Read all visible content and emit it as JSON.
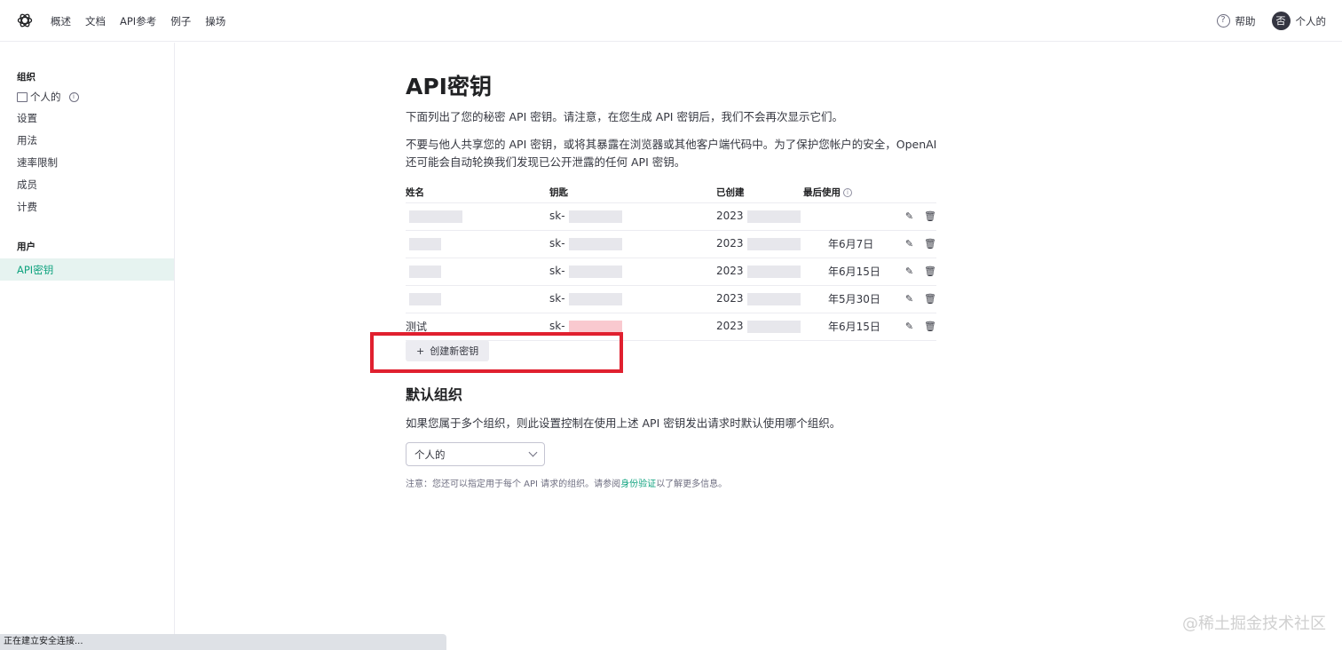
{
  "nav": {
    "links": [
      "概述",
      "文档",
      "API参考",
      "例子",
      "操场"
    ],
    "help": "帮助",
    "avatar_letter": "否",
    "account": "个人的"
  },
  "sidebar": {
    "org_heading": "组织",
    "org_name": "个人的",
    "items": [
      "设置",
      "用法",
      "速率限制",
      "成员",
      "计费"
    ],
    "user_heading": "用户",
    "active_item": "API密钥"
  },
  "main": {
    "title": "API密钥",
    "desc1": "下面列出了您的秘密 API 密钥。请注意，在您生成 API 密钥后，我们不会再次显示它们。",
    "desc2": "不要与他人共享您的 API 密钥，或将其暴露在浏览器或其他客户端代码中。为了保护您帐户的安全，OpenAI 还可能会自动轮换我们发现已公开泄露的任何 API 密钥。",
    "table": {
      "headers": [
        "姓名",
        "钥匙",
        "已创建",
        "最后使用"
      ],
      "rows": [
        {
          "name": "",
          "key": "sk-",
          "created": "2023",
          "last": ""
        },
        {
          "name": "",
          "key": "sk-",
          "created": "2023",
          "last": "年6月7日"
        },
        {
          "name": "",
          "key": "sk-",
          "created": "2023",
          "last": "年6月15日"
        },
        {
          "name": "",
          "key": "sk-",
          "created": "2023",
          "last": "年5月30日"
        },
        {
          "name": "测试",
          "key": "sk-",
          "created": "2023",
          "last": "年6月15日"
        }
      ]
    },
    "create_button": "创建新密钥",
    "default_org_title": "默认组织",
    "default_org_desc": "如果您属于多个组织，则此设置控制在使用上述 API 密钥发出请求时默认使用哪个组织。",
    "org_select_value": "个人的",
    "note_prefix": "注意：您还可以指定用于每个 API 请求的组织。请参阅",
    "note_link": "身份验证",
    "note_suffix": "以了解更多信息。"
  },
  "statusbar": "正在建立安全连接...",
  "watermark": "@稀土掘金技术社区",
  "colors": {
    "accent": "#10a37f",
    "highlight": "#e0202f"
  }
}
